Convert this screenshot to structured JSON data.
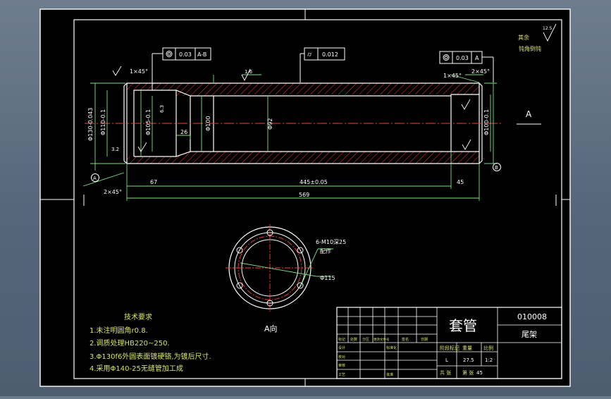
{
  "drawing": {
    "view_label": "A",
    "section_label": "A向",
    "roughness_note": [
      "其余",
      "钝角倒钝"
    ],
    "roughness_main": "12.5"
  },
  "tolerances": {
    "left": {
      "value": "0.03",
      "ref": "A-B"
    },
    "mid": {
      "value": "0.012"
    },
    "right": {
      "value": "0.03",
      "ref": "A"
    }
  },
  "dimensions": {
    "chamfer_left_top": "1×45°",
    "chamfer_right_top": "1×45°",
    "chamfer_right_top2": "2×45°",
    "chamfer_bottom_left": "2×45°",
    "len_67": "67",
    "len_445": "445±0.05",
    "len_45": "45",
    "len_569": "569",
    "len_26": "26",
    "dia_130": "Φ130-0.043",
    "dia_110": "Φ110-0.1",
    "dia_105": "Φ105-0.1",
    "dia_100": "Φ100",
    "dia_92": "Φ92",
    "dia_right": "Φ100-0.1",
    "rough_16": "1.6",
    "rough_63": "6.3",
    "rough_32": "3.2",
    "hole_note": [
      "6-M10深25",
      "配作"
    ],
    "pcd": "Φ115"
  },
  "datums": {
    "a": "A",
    "b": "B"
  },
  "notes": {
    "title": "技术要求",
    "items": [
      "1.未注明圆角r0.8.",
      "2.调质处理HB220~250.",
      "3.Φ130f6外圆表面镀硬铬,为镀后尺寸.",
      "4.采用Φ140-25无缝管加工成"
    ]
  },
  "title_block": {
    "part_name": "套管",
    "drawing_no": "010008",
    "assembly": "尾架",
    "head_labels": [
      "标记",
      "处数",
      "分区",
      "更改文件号",
      "签名",
      "日期"
    ],
    "row_labels": [
      "设计",
      "标准化",
      "校对",
      "审核",
      "工艺",
      "批准"
    ],
    "stage_label": "阶段标记",
    "weight_label": "重量",
    "scale_label": "比例",
    "stage_value": "L",
    "weight_value": "27.5",
    "scale_value": "1:2",
    "sheet_label": "共 张",
    "sheet2_label": "第 张",
    "material": "45"
  }
}
